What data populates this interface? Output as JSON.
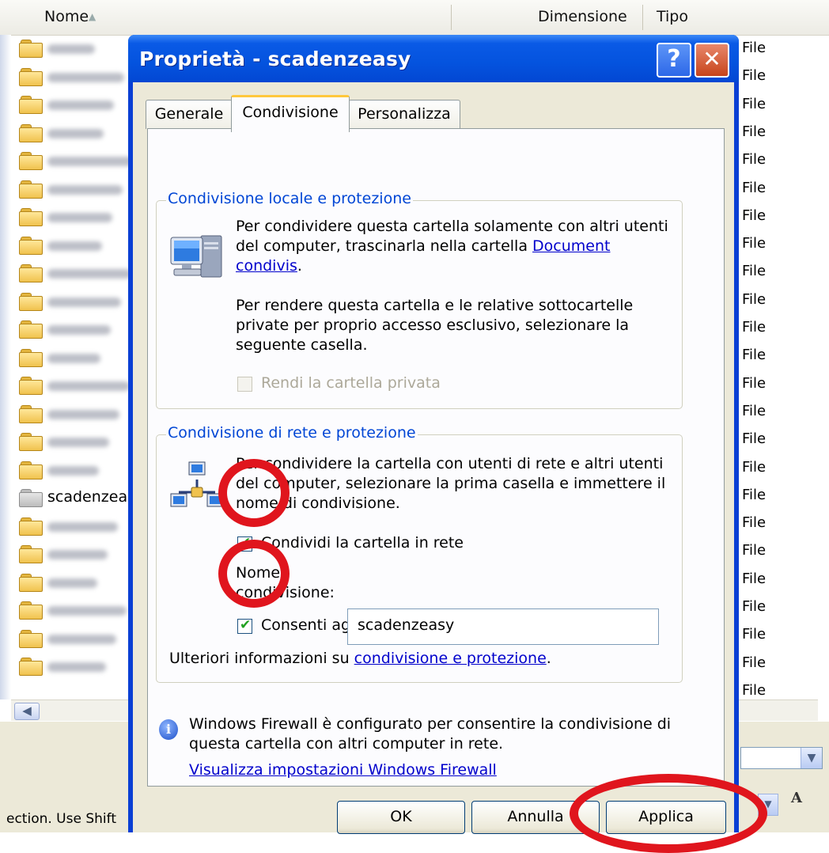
{
  "explorer": {
    "col_name": "Nome",
    "col_size": "Dimensione",
    "col_type": "Tipo",
    "selected_row_name": "scadenzea",
    "row_type": "File",
    "status_text": "ection.  Use Shift"
  },
  "dialog": {
    "title": "Proprietà - scadenzeasy",
    "help_button": "?",
    "close_button": "✕",
    "tabs": [
      "Generale",
      "Condivisione",
      "Personalizza"
    ],
    "local_group": {
      "title": "Condivisione locale e protezione",
      "para1_prefix": "Per condividere questa cartella solamente con altri utenti del computer, trascinarla nella cartella ",
      "para1_link": "Document condivis",
      "para1_suffix": ".",
      "para2": "Per rendere questa cartella e le relative sottocartelle private per proprio accesso esclusivo, selezionare la seguente casella.",
      "private_checkbox": "Rendi la cartella privata"
    },
    "network_group": {
      "title": "Condivisione di rete e protezione",
      "para": "Per condividere la cartella con utenti di rete e altri utenti del computer, selezionare la prima casella e immettere il nome di condivisione.",
      "share_checkbox": "Condividi la cartella in rete",
      "share_name_label": "Nome condivisione:",
      "share_name_value": "scadenzeasy",
      "modify_checkbox": "Consenti agli utenti di rete di modificare i file",
      "more_info_prefix": "Ulteriori informazioni su ",
      "more_info_link": "condivisione e protezione",
      "more_info_suffix": "."
    },
    "firewall_text": "Windows Firewall è configurato per consentire la condivisione di questa cartella con altri computer in rete.",
    "firewall_link": "Visualizza impostazioni Windows Firewall",
    "buttons": {
      "ok": "OK",
      "cancel": "Annulla",
      "apply": "Applica"
    }
  },
  "colors": {
    "annotation_ring": "#e0151d",
    "title_bar": "#0453de",
    "link": "#0000cc",
    "group_title": "#0046d5"
  },
  "icons": [
    "folder-icon",
    "shared-folder-icon",
    "computer-icon",
    "network-icon",
    "info-icon",
    "help-icon",
    "close-icon",
    "scroll-left-icon",
    "dropdown-arrow-icon",
    "font-size-icon"
  ]
}
